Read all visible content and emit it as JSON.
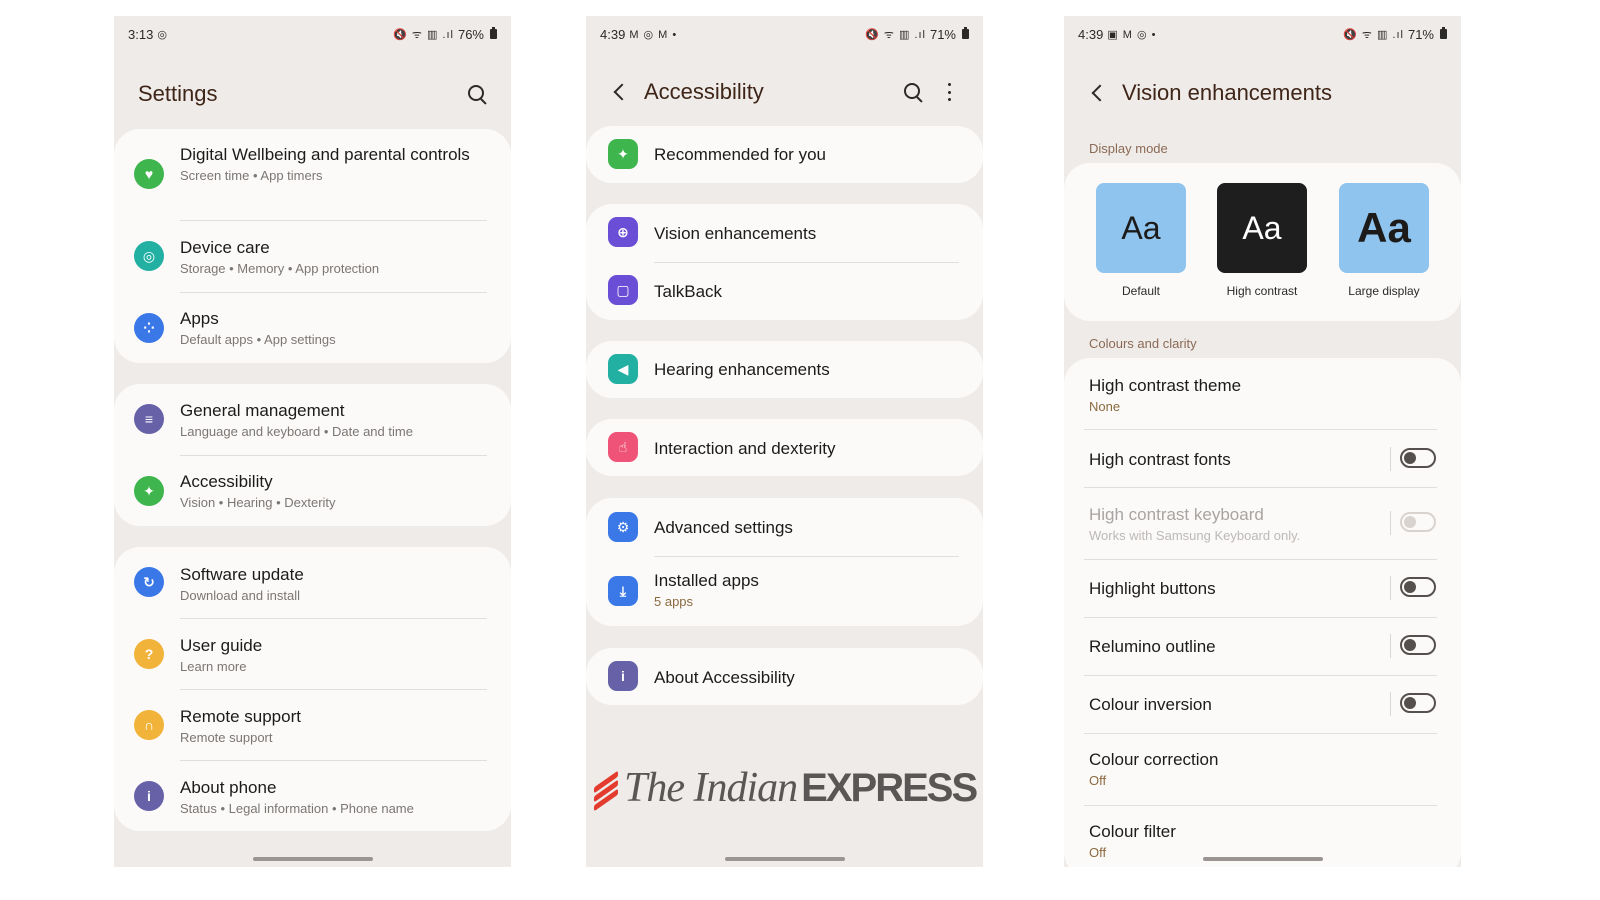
{
  "screen1": {
    "status": {
      "time": "3:13",
      "left_icons": "◎",
      "right_icons": "🔇 ᯤ ▥ .ıl",
      "battery": "76%"
    },
    "title": "Settings",
    "groups": [
      [
        {
          "title": "Digital Wellbeing and parental controls",
          "subtitle": "Screen time  •  App timers",
          "icon": "heart-icon",
          "color": "#3fb54e"
        },
        {
          "title": "Device care",
          "subtitle": "Storage  •  Memory  •  App protection",
          "icon": "device-care-icon",
          "color": "#22b0a3"
        },
        {
          "title": "Apps",
          "subtitle": "Default apps  •  App settings",
          "icon": "apps-grid-icon",
          "color": "#3b78e7"
        }
      ],
      [
        {
          "title": "General management",
          "subtitle": "Language and keyboard  •  Date and time",
          "icon": "sliders-icon",
          "color": "#6761a8"
        },
        {
          "title": "Accessibility",
          "subtitle": "Vision  •  Hearing  •  Dexterity",
          "icon": "accessibility-icon",
          "color": "#3fb54e"
        }
      ],
      [
        {
          "title": "Software update",
          "subtitle": "Download and install",
          "icon": "update-icon",
          "color": "#3b78e7"
        },
        {
          "title": "User guide",
          "subtitle": "Learn more",
          "icon": "guide-icon",
          "color": "#f2b33a"
        },
        {
          "title": "Remote support",
          "subtitle": "Remote support",
          "icon": "headset-icon",
          "color": "#f2b33a"
        },
        {
          "title": "About phone",
          "subtitle": "Status  •  Legal information  •  Phone name",
          "icon": "info-icon",
          "color": "#6761a8"
        }
      ]
    ]
  },
  "screen2": {
    "status": {
      "time": "4:39",
      "left_icons": "M ◎ M •",
      "right_icons": "🔇 ᯤ ▥ .ıl",
      "battery": "71%"
    },
    "title": "Accessibility",
    "groups": [
      [
        {
          "title": "Recommended for you",
          "subtitle": "",
          "icon": "recommended-icon",
          "color": "#3fb54e"
        }
      ],
      [
        {
          "title": "Vision enhancements",
          "subtitle": "",
          "icon": "magnifier-icon",
          "color": "#6a4fd6"
        },
        {
          "title": "TalkBack",
          "subtitle": "",
          "icon": "talkback-icon",
          "color": "#6a4fd6"
        }
      ],
      [
        {
          "title": "Hearing enhancements",
          "subtitle": "",
          "icon": "speaker-icon",
          "color": "#22b0a3"
        }
      ],
      [
        {
          "title": "Interaction and dexterity",
          "subtitle": "",
          "icon": "touch-icon",
          "color": "#ef5478"
        }
      ],
      [
        {
          "title": "Advanced settings",
          "subtitle": "",
          "icon": "gear-plus-icon",
          "color": "#3b78e7"
        },
        {
          "title": "Installed apps",
          "subtitle": "5 apps",
          "icon": "download-icon",
          "color": "#3b78e7"
        }
      ],
      [
        {
          "title": "About Accessibility",
          "subtitle": "",
          "icon": "info-icon",
          "color": "#6761a8"
        }
      ]
    ],
    "watermark": {
      "part1": "The Indian",
      "part2": "EXPRESS"
    }
  },
  "screen3": {
    "status": {
      "time": "4:39",
      "left_icons": "▣ M ◎ •",
      "right_icons": "🔇 ᯤ ▥ .ıl",
      "battery": "71%"
    },
    "title": "Vision enhancements",
    "display_mode_label": "Display mode",
    "modes": [
      {
        "glyph": "Aa",
        "label": "Default",
        "bg": "#8fc4ee",
        "fg": "#1d1b1a"
      },
      {
        "glyph": "Aa",
        "label": "High contrast",
        "bg": "#1e1e1e",
        "fg": "#ffffff"
      },
      {
        "glyph": "Aa",
        "label": "Large display",
        "bg": "#8fc4ee",
        "fg": "#1d1b1a"
      }
    ],
    "colours_label": "Colours and clarity",
    "items": [
      {
        "title": "High contrast theme",
        "subtitle": "None",
        "toggle": null,
        "disabled": false
      },
      {
        "title": "High contrast fonts",
        "subtitle": "",
        "toggle": false,
        "disabled": false
      },
      {
        "title": "High contrast keyboard",
        "subtitle": "Works with Samsung Keyboard only.",
        "toggle": false,
        "disabled": true
      },
      {
        "title": "Highlight buttons",
        "subtitle": "",
        "toggle": false,
        "disabled": false
      },
      {
        "title": "Relumino outline",
        "subtitle": "",
        "toggle": false,
        "disabled": false
      },
      {
        "title": "Colour inversion",
        "subtitle": "",
        "toggle": false,
        "disabled": false
      },
      {
        "title": "Colour correction",
        "subtitle": "Off",
        "toggle": null,
        "disabled": false
      },
      {
        "title": "Colour filter",
        "subtitle": "Off",
        "toggle": null,
        "disabled": false
      }
    ]
  }
}
